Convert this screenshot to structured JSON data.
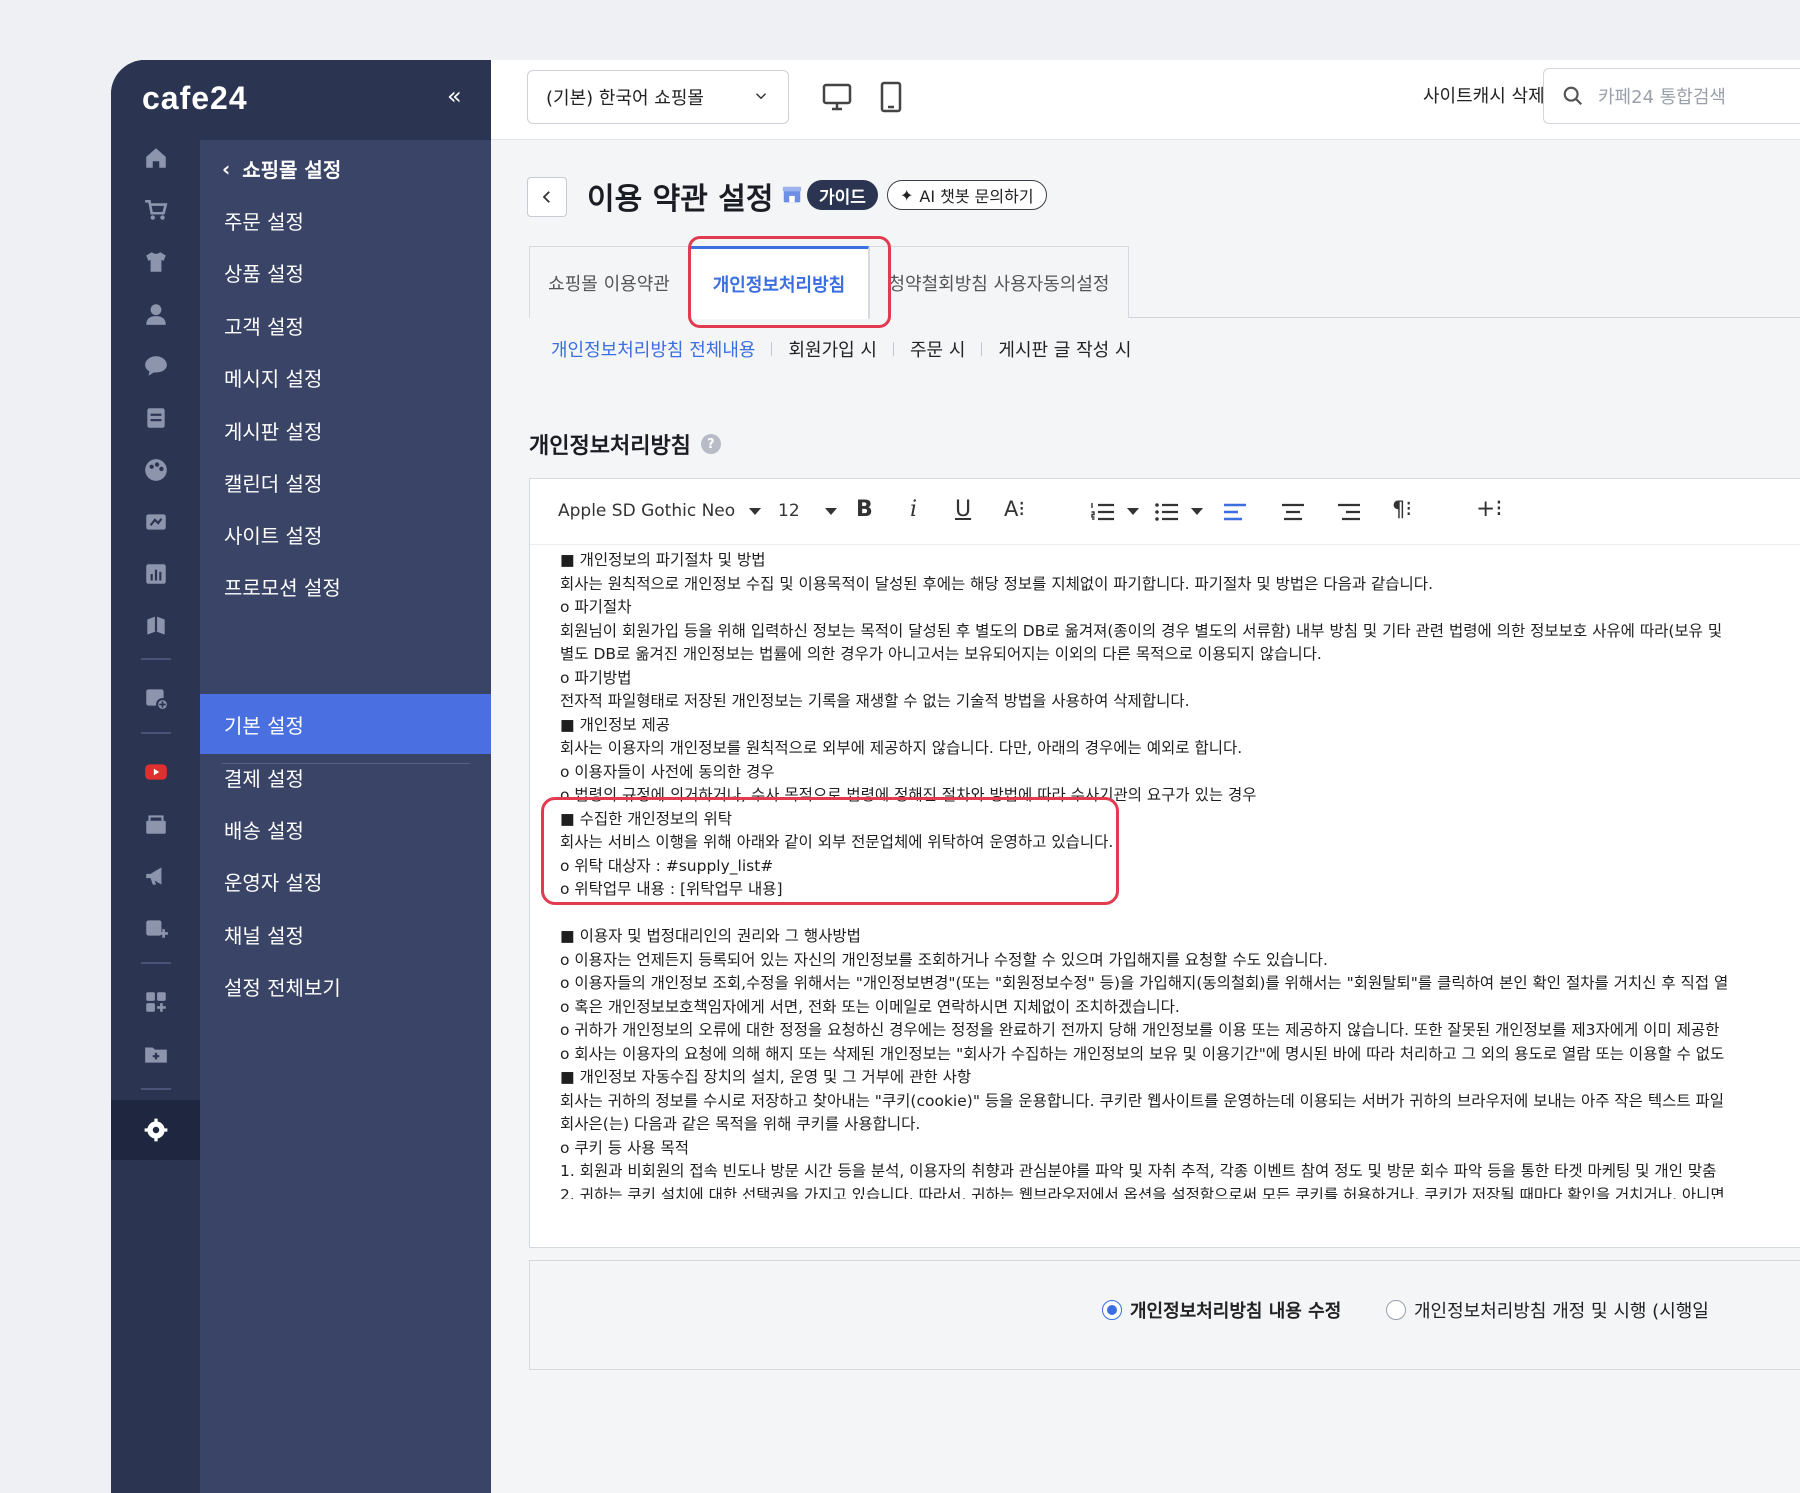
{
  "brand": {
    "logo": "cafe24",
    "collapse": "«"
  },
  "topbar": {
    "language_select": "(기본) 한국어 쇼핑몰",
    "cache_button": "사이트캐시 삭제",
    "search_placeholder": "카페24 통합검색"
  },
  "submenu": {
    "back_label": "쇼핑몰 설정",
    "items_top": [
      "주문 설정",
      "상품 설정",
      "고객 설정",
      "메시지 설정",
      "게시판 설정",
      "캘린더 설정",
      "사이트 설정",
      "프로모션 설정"
    ],
    "items_bottom": [
      "기본 설정",
      "결제 설정",
      "배송 설정",
      "운영자 설정",
      "채널 설정",
      "설정 전체보기"
    ],
    "active": "기본 설정"
  },
  "page": {
    "title": "이용 약관 설정",
    "guide_badge": "가이드",
    "ai_button": "AI 챗봇 문의하기"
  },
  "tabs": [
    "쇼핑몰 이용약관",
    "개인정보처리방침",
    "청약철회방침 사용자동의설정"
  ],
  "subtabs": [
    "개인정보처리방침 전체내용",
    "회원가입 시",
    "주문 시",
    "게시판 글 작성 시"
  ],
  "section_title": "개인정보처리방침",
  "toolbar": {
    "font_family": "Apple SD Gothic Neo",
    "font_size": "12"
  },
  "editor_lines": [
    "■ 개인정보의 파기절차 및 방법",
    "회사는 원칙적으로 개인정보 수집 및 이용목적이 달성된 후에는 해당 정보를 지체없이 파기합니다. 파기절차 및 방법은 다음과 같습니다.",
    "o 파기절차",
    "회원님이 회원가입 등을 위해 입력하신 정보는 목적이 달성된 후 별도의 DB로 옮겨져(종이의 경우 별도의 서류함) 내부 방침 및 기타 관련 법령에 의한 정보보호 사유에 따라(보유 및",
    "별도 DB로 옮겨진 개인정보는 법률에 의한 경우가 아니고서는 보유되어지는 이외의 다른 목적으로 이용되지 않습니다.",
    "o 파기방법",
    "전자적 파일형태로 저장된 개인정보는 기록을 재생할 수 없는 기술적 방법을 사용하여 삭제합니다.",
    "■ 개인정보 제공",
    "회사는 이용자의 개인정보를 원칙적으로 외부에 제공하지 않습니다. 다만, 아래의 경우에는 예외로 합니다.",
    "o 이용자들이 사전에 동의한 경우",
    "o 법령의 규정에 의거하거나, 수사 목적으로 법령에 정해진 절차와 방법에 따라 수사기관의 요구가 있는 경우",
    "■ 수집한 개인정보의 위탁",
    "회사는 서비스 이행을 위해 아래와 같이 외부 전문업체에 위탁하여 운영하고 있습니다.",
    "o 위탁 대상자 : #supply_list#",
    "o 위탁업무 내용 : [위탁업무 내용]",
    "",
    "■ 이용자 및 법정대리인의 권리와 그 행사방법",
    "o 이용자는 언제든지 등록되어 있는 자신의 개인정보를 조회하거나 수정할 수 있으며 가입해지를 요청할 수도 있습니다.",
    "o 이용자들의 개인정보 조회,수정을 위해서는 \"개인정보변경\"(또는 \"회원정보수정\" 등)을 가입해지(동의철회)를 위해서는 \"회원탈퇴\"를 클릭하여 본인 확인 절차를 거치신 후 직접 열",
    "o 혹은 개인정보보호책임자에게 서면, 전화 또는 이메일로 연락하시면 지체없이 조치하겠습니다.",
    "o 귀하가 개인정보의 오류에 대한 정정을 요청하신 경우에는 정정을 완료하기 전까지 당해 개인정보를 이용 또는 제공하지 않습니다. 또한 잘못된 개인정보를 제3자에게 이미 제공한",
    "o 회사는 이용자의 요청에 의해 해지 또는 삭제된 개인정보는 \"회사가 수집하는 개인정보의 보유 및 이용기간\"에 명시된 바에 따라 처리하고 그 외의 용도로 열람 또는 이용할 수 없도",
    "■ 개인정보 자동수집 장치의 설치, 운영 및 그 거부에 관한 사항",
    "회사는 귀하의 정보를 수시로 저장하고 찾아내는 \"쿠키(cookie)\" 등을 운용합니다. 쿠키란 웹사이트를 운영하는데 이용되는 서버가 귀하의 브라우저에 보내는 아주 작은 텍스트 파일",
    "회사은(는) 다음과 같은 목적을 위해 쿠키를 사용합니다.",
    "o 쿠키 등 사용 목적",
    "1. 회원과 비회원의 접속 빈도나 방문 시간 등을 분석, 이용자의 취향과 관심분야를 파악 및 자취 추적, 각종 이벤트 참여 정도 및 방문 회수 파악 등을 통한 타겟 마케팅 및 개인 맞춤",
    "2. 귀하는 쿠키 설치에 대한 선택권을 가지고 있습니다. 따라서, 귀하는 웹브라우저에서 옵션을 설정함으로써 모든 쿠키를 허용하거나, 쿠키가 저장될 때마다 확인을 거치거나, 아니면"
  ],
  "footer": {
    "option_edit": "개인정보처리방침 내용 수정",
    "option_revise": "개인정보처리방침 개정 및 시행  (시행일"
  },
  "colors": {
    "sidebar": "#2b3451",
    "accent": "#3b6ee0",
    "highlight": "#e23b4f"
  }
}
